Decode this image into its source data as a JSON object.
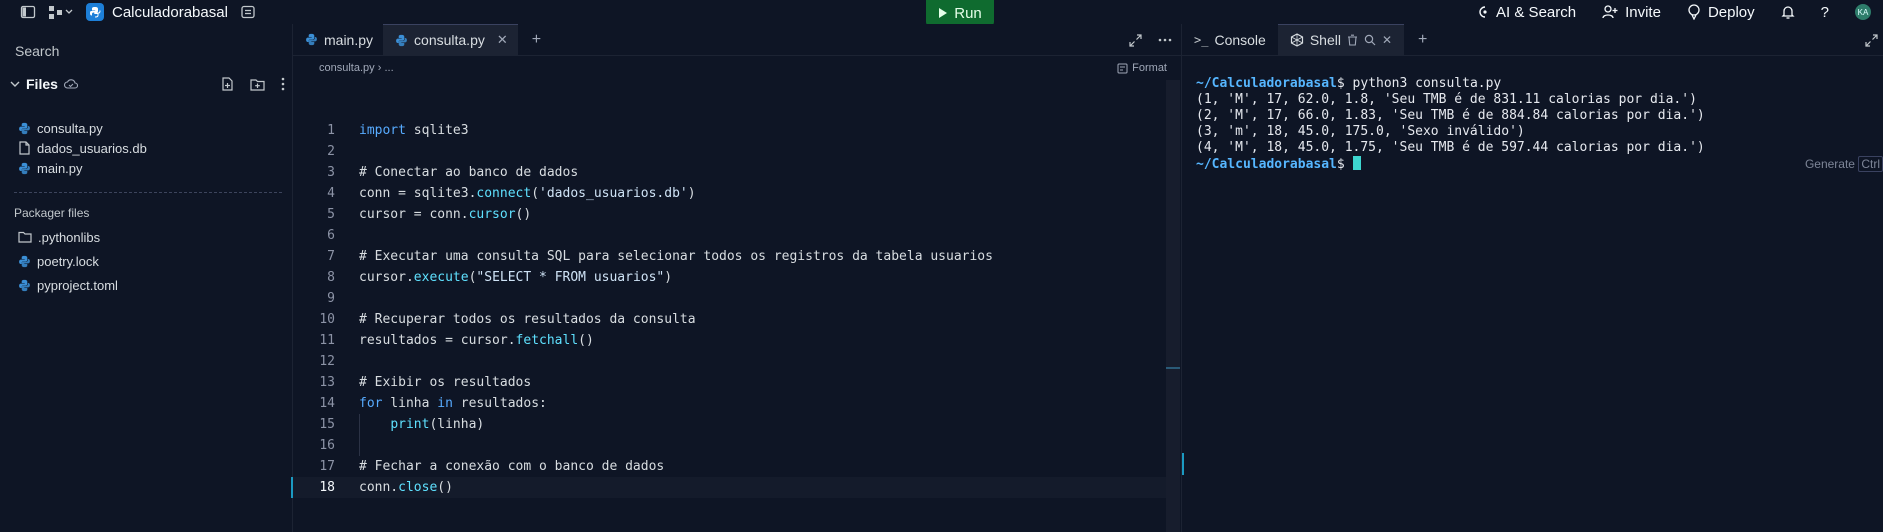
{
  "topbar": {
    "app_title": "Calculadorabasal",
    "run_label": "Run",
    "ai_search_label": "AI & Search",
    "invite_label": "Invite",
    "deploy_label": "Deploy",
    "avatar_initials": "KA"
  },
  "sidebar": {
    "search_label": "Search",
    "files_label": "Files",
    "files": [
      {
        "name": "consulta.py",
        "icon": "python-icon"
      },
      {
        "name": "dados_usuarios.db",
        "icon": "file-icon"
      },
      {
        "name": "main.py",
        "icon": "python-icon"
      }
    ],
    "packager_label": "Packager files",
    "packager_files": [
      {
        "name": ".pythonlibs",
        "icon": "folder-icon"
      },
      {
        "name": "poetry.lock",
        "icon": "python-icon"
      },
      {
        "name": "pyproject.toml",
        "icon": "python-icon"
      }
    ]
  },
  "editor": {
    "tabs": [
      {
        "label": "main.py",
        "active": false
      },
      {
        "label": "consulta.py",
        "active": true
      }
    ],
    "breadcrumb_file": "consulta.py",
    "breadcrumb_more": "...",
    "format_label": "Format",
    "current_line": 18,
    "line_numbers": [
      "1",
      "2",
      "3",
      "4",
      "5",
      "6",
      "7",
      "8",
      "9",
      "10",
      "11",
      "12",
      "13",
      "14",
      "15",
      "16",
      "17",
      "18"
    ]
  },
  "shell": {
    "tabs": [
      {
        "label": "Console",
        "active": false
      },
      {
        "label": "Shell",
        "active": true
      }
    ],
    "prompt_path": "~/Calculadorabasal",
    "prompt_symbol": "$",
    "command": " python3 consulta.py",
    "output": [
      "(1, 'M', 17, 62.0, 1.8, 'Seu TMB é de 831.11 calorias por dia.')",
      "(2, 'M', 17, 66.0, 1.83, 'Seu TMB é de 884.84 calorias por dia.')",
      "(3, 'm', 18, 45.0, 175.0, 'Sexo inválido')",
      "(4, 'M', 18, 45.0, 1.75, 'Seu TMB é de 597.44 calorias por dia.')"
    ],
    "generate_label": "Generate",
    "generate_key": "Ctrl"
  },
  "colors": {
    "background": "#0e1525",
    "run_button": "#0f6b2f",
    "accent": "#1b9ac2",
    "prompt_path": "#56b6ff"
  }
}
